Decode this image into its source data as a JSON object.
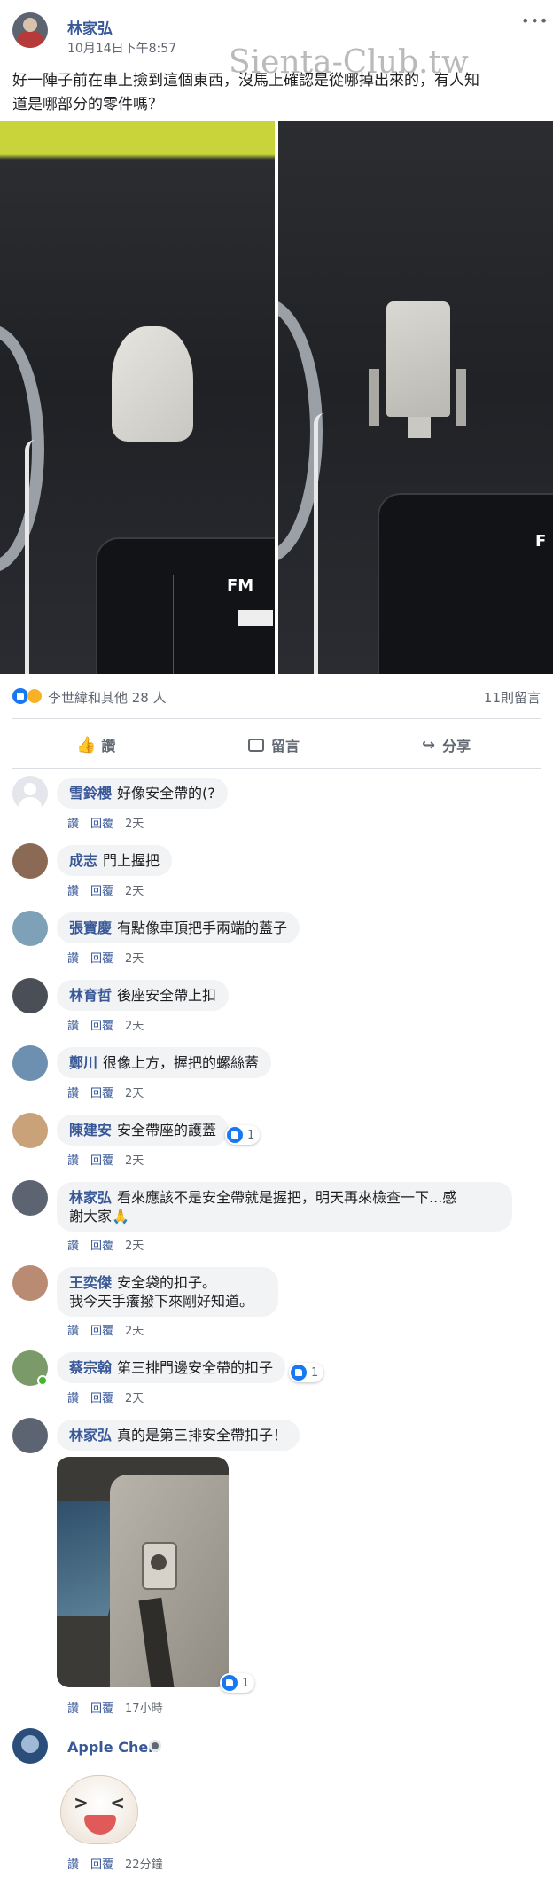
{
  "watermark": "Sienta-Club.tw",
  "post": {
    "author": "林家弘",
    "timestamp": "10月14日下午8:57",
    "more_label": "•••",
    "text_line1": "好一陣子前在車上撿到這個東西，沒馬上確認是從哪掉出來的，有人知",
    "text_line2": "道是哪部分的零件嗎？",
    "photo_label_left": "FM",
    "photo_label_right": "F",
    "reactions_text": "李世緯和其他 28 人",
    "comments_count": "11則留言"
  },
  "actions": {
    "like": "讚",
    "comment": "留言",
    "share": "分享"
  },
  "comment_actions": {
    "like": "讚",
    "reply": "回覆"
  },
  "comments": [
    {
      "name": "雪鈴櫻",
      "text": "好像安全帶的(?",
      "time": "2天",
      "avatar": "#e4e6eb"
    },
    {
      "name": "成志",
      "text": "門上握把",
      "time": "2天",
      "avatar": "#8a6a55"
    },
    {
      "name": "張寶慶",
      "text": "有點像車頂把手兩端的蓋子",
      "time": "2天",
      "avatar": "#7fa1b8"
    },
    {
      "name": "林育哲",
      "text": "後座安全帶上扣",
      "time": "2天",
      "avatar": "#4a4e56"
    },
    {
      "name": "鄭川",
      "text": "很像上方，握把的螺絲蓋",
      "time": "2天",
      "avatar": "#6d8fb0"
    },
    {
      "name": "陳建安",
      "text": "安全帶座的護蓋",
      "time": "2天",
      "avatar": "#c9a27a",
      "reaction": "1"
    },
    {
      "name": "林家弘",
      "text": "看來應該不是安全帶就是握把，明天再來檢查一下...感",
      "text2": "謝大家🙏",
      "time": "2天",
      "avatar": "#5b6470"
    },
    {
      "name": "王奕傑",
      "text": "安全袋的扣子。",
      "text2": "我今天手癢撥下來剛好知道。",
      "time": "2天",
      "avatar": "#b98b73"
    },
    {
      "name": "蔡宗翰",
      "text": "第三排門邊安全帶的扣子",
      "time": "2天",
      "avatar": "#7a9a6a",
      "reaction": "1"
    },
    {
      "name": "林家弘",
      "text": "真的是第三排安全帶扣子！",
      "time": "17小時",
      "avatar": "#5b6470",
      "reaction": "1"
    },
    {
      "name": "Apple Chen",
      "time": "22分鐘",
      "avatar": "#2a4d7a"
    }
  ]
}
